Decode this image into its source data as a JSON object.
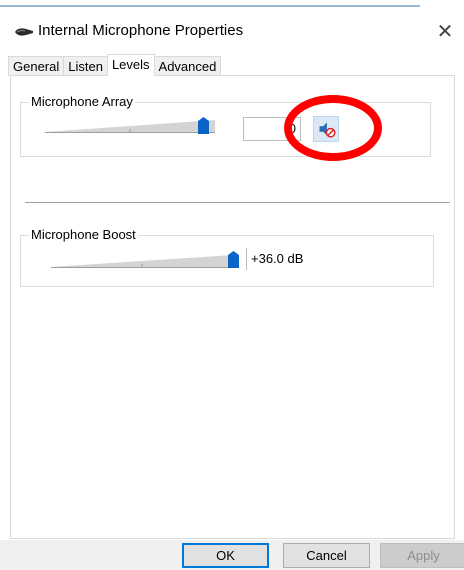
{
  "window": {
    "title": "Internal Microphone Properties",
    "close_glyph": "✕",
    "icon": "microphone-icon"
  },
  "tabs": [
    {
      "label": "General",
      "active": false
    },
    {
      "label": "Listen",
      "active": false
    },
    {
      "label": "Levels",
      "active": true
    },
    {
      "label": "Advanced",
      "active": false
    }
  ],
  "levels": {
    "microphone_array": {
      "label": "Microphone Array",
      "value": "0",
      "slider_level": 0.93,
      "mute_icon": "speaker-muted-icon"
    },
    "microphone_boost": {
      "label": "Microphone Boost",
      "value": "+36.0 dB",
      "slider_level": 1.0
    }
  },
  "buttons": {
    "ok": "OK",
    "cancel": "Cancel",
    "apply": "Apply"
  },
  "colors": {
    "accent": "#0078d7",
    "annotation": "#ff0000"
  }
}
